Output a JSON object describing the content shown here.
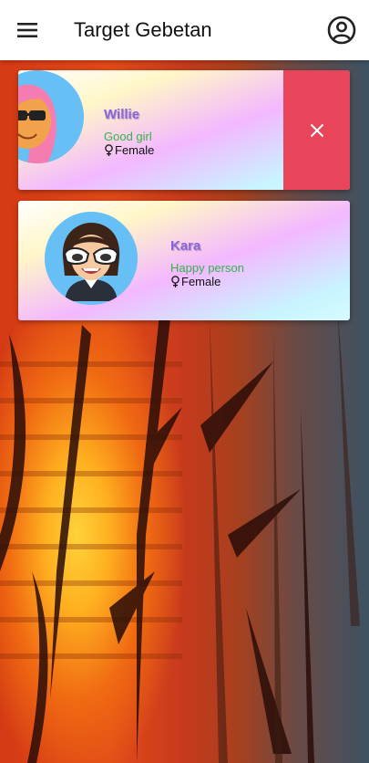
{
  "appbar": {
    "title": "Target Gebetan",
    "menu_icon": "menu-icon",
    "account_icon": "account-circle-icon"
  },
  "contacts": [
    {
      "name": "Willie",
      "status": "Good girl",
      "gender": "Female",
      "swiped_open": true,
      "action_icon": "close-icon"
    },
    {
      "name": "Kara",
      "status": "Happy person",
      "gender": "Female",
      "swiped_open": false
    }
  ],
  "colors": {
    "name": "#8a66d6",
    "status": "#35b34a",
    "delete_action": "#e8445a"
  }
}
